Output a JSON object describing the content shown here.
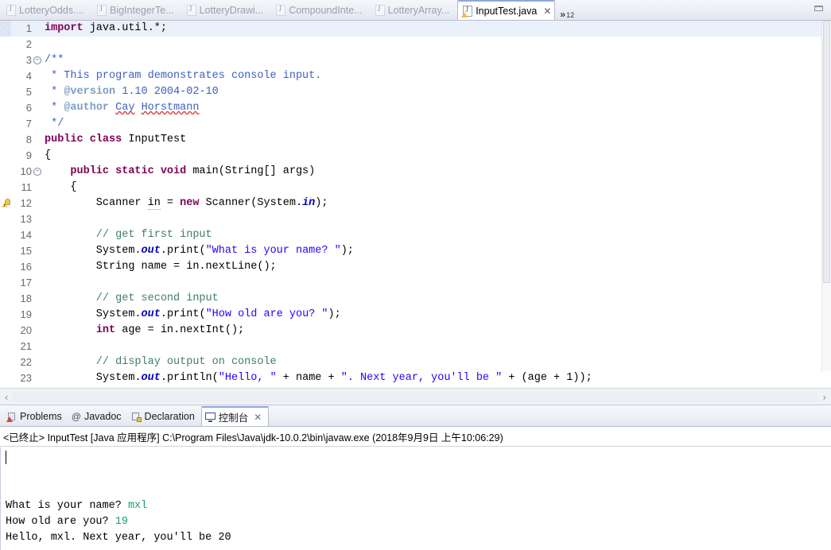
{
  "editor_tabs": [
    {
      "label": "LotteryOdds....",
      "icon": "java-file-icon",
      "active": false
    },
    {
      "label": "BigIntegerTe...",
      "icon": "java-file-icon",
      "active": false
    },
    {
      "label": "LotteryDrawi...",
      "icon": "java-file-icon",
      "active": false
    },
    {
      "label": "CompoundInte...",
      "icon": "java-file-icon",
      "active": false
    },
    {
      "label": "LotteryArray...",
      "icon": "java-file-icon",
      "active": false
    },
    {
      "label": "InputTest.java",
      "icon": "java-file-warning-icon",
      "active": true
    }
  ],
  "tab_overflow": {
    "chevron": "»",
    "count": "12"
  },
  "window_controls": {
    "minimize": "minimize-icon"
  },
  "editor": {
    "active_file": "InputTest.java",
    "close_label": "✕",
    "current_line": 1,
    "warning_line": 12,
    "folding_lines": [
      3,
      10
    ],
    "lines": [
      {
        "n": "1",
        "tokens": [
          {
            "t": "import",
            "c": "kw"
          },
          {
            "t": " java.util.*;",
            "c": "plain"
          }
        ]
      },
      {
        "n": "2",
        "tokens": []
      },
      {
        "n": "3",
        "tokens": [
          {
            "t": "/**",
            "c": "jdoc"
          }
        ]
      },
      {
        "n": "4",
        "tokens": [
          {
            "t": " * This program demonstrates console input.",
            "c": "jdoc"
          }
        ]
      },
      {
        "n": "5",
        "tokens": [
          {
            "t": " * ",
            "c": "jdoc"
          },
          {
            "t": "@version",
            "c": "jtag"
          },
          {
            "t": " 1.10 2004-02-10",
            "c": "jdoc"
          }
        ]
      },
      {
        "n": "6",
        "tokens": [
          {
            "t": " * ",
            "c": "jdoc"
          },
          {
            "t": "@author",
            "c": "jtag"
          },
          {
            "t": " ",
            "c": "jdoc"
          },
          {
            "t": "Cay",
            "c": "jdoc spell"
          },
          {
            "t": " ",
            "c": "jdoc"
          },
          {
            "t": "Horstmann",
            "c": "jdoc spell"
          }
        ]
      },
      {
        "n": "7",
        "tokens": [
          {
            "t": " */",
            "c": "jdoc"
          }
        ]
      },
      {
        "n": "8",
        "tokens": [
          {
            "t": "public class",
            "c": "kw"
          },
          {
            "t": " InputTest",
            "c": "plain"
          }
        ]
      },
      {
        "n": "9",
        "tokens": [
          {
            "t": "{",
            "c": "plain"
          }
        ]
      },
      {
        "n": "10",
        "tokens": [
          {
            "t": "    ",
            "c": "plain"
          },
          {
            "t": "public static void",
            "c": "kw"
          },
          {
            "t": " main(String[] args)",
            "c": "plain"
          }
        ]
      },
      {
        "n": "11",
        "tokens": [
          {
            "t": "    {",
            "c": "plain"
          }
        ]
      },
      {
        "n": "12",
        "tokens": [
          {
            "t": "        Scanner ",
            "c": "plain"
          },
          {
            "t": "in",
            "c": "plain spellu"
          },
          {
            "t": " = ",
            "c": "plain"
          },
          {
            "t": "new",
            "c": "kw"
          },
          {
            "t": " Scanner(System.",
            "c": "plain"
          },
          {
            "t": "in",
            "c": "fld"
          },
          {
            "t": ");",
            "c": "plain"
          }
        ]
      },
      {
        "n": "13",
        "tokens": []
      },
      {
        "n": "14",
        "tokens": [
          {
            "t": "        // get first input",
            "c": "cmt"
          }
        ]
      },
      {
        "n": "15",
        "tokens": [
          {
            "t": "        System.",
            "c": "plain"
          },
          {
            "t": "out",
            "c": "fld"
          },
          {
            "t": ".print(",
            "c": "plain"
          },
          {
            "t": "\"What is your name? \"",
            "c": "str"
          },
          {
            "t": ");",
            "c": "plain"
          }
        ]
      },
      {
        "n": "16",
        "tokens": [
          {
            "t": "        String name = in.nextLine();",
            "c": "plain"
          }
        ]
      },
      {
        "n": "17",
        "tokens": []
      },
      {
        "n": "18",
        "tokens": [
          {
            "t": "        // get second input",
            "c": "cmt"
          }
        ]
      },
      {
        "n": "19",
        "tokens": [
          {
            "t": "        System.",
            "c": "plain"
          },
          {
            "t": "out",
            "c": "fld"
          },
          {
            "t": ".print(",
            "c": "plain"
          },
          {
            "t": "\"How old are you? \"",
            "c": "str"
          },
          {
            "t": ");",
            "c": "plain"
          }
        ]
      },
      {
        "n": "20",
        "tokens": [
          {
            "t": "        ",
            "c": "plain"
          },
          {
            "t": "int",
            "c": "kw"
          },
          {
            "t": " age = in.nextInt();",
            "c": "plain"
          }
        ]
      },
      {
        "n": "21",
        "tokens": []
      },
      {
        "n": "22",
        "tokens": [
          {
            "t": "        // display output on console",
            "c": "cmt"
          }
        ]
      },
      {
        "n": "23",
        "tokens": [
          {
            "t": "        System.",
            "c": "plain"
          },
          {
            "t": "out",
            "c": "fld"
          },
          {
            "t": ".println(",
            "c": "plain"
          },
          {
            "t": "\"Hello, \"",
            "c": "str"
          },
          {
            "t": " + name + ",
            "c": "plain"
          },
          {
            "t": "\". Next year, you'll be \"",
            "c": "str"
          },
          {
            "t": " + (age + ",
            "c": "plain"
          },
          {
            "t": "1",
            "c": "plain"
          },
          {
            "t": "));",
            "c": "plain"
          }
        ]
      }
    ],
    "hscroll": {
      "left_arrow": "‹",
      "right_arrow": "›"
    }
  },
  "bottom_panel": {
    "tabs": [
      {
        "label": "Problems",
        "icon": "problems-icon",
        "active": false
      },
      {
        "label": "Javadoc",
        "icon": "javadoc-icon",
        "active": false
      },
      {
        "label": "Declaration",
        "icon": "declaration-icon",
        "active": false
      },
      {
        "label": "控制台",
        "icon": "console-icon",
        "active": true
      }
    ],
    "close_label": "✕",
    "console": {
      "header": "<已终止> InputTest [Java 应用程序] C:\\Program Files\\Java\\jdk-10.0.2\\bin\\javaw.exe (2018年9月9日 上午10:06:29)",
      "lines": [
        {
          "prompt": "What is your name? ",
          "input": "mxl"
        },
        {
          "prompt": "How old are you? ",
          "input": "19"
        },
        {
          "prompt": "Hello, mxl. Next year, you'll be 20",
          "input": ""
        }
      ]
    }
  },
  "colors": {
    "keyword": "#7f0055",
    "string": "#2a00ff",
    "comment": "#3f7f5f",
    "javadoc": "#3f5fbf",
    "javadoc_tag": "#7f9fbf",
    "static_field": "#0000c0",
    "console_input": "#1f9d6a",
    "current_line": "#eaf1fb",
    "tab_border": "#b6bccd"
  }
}
